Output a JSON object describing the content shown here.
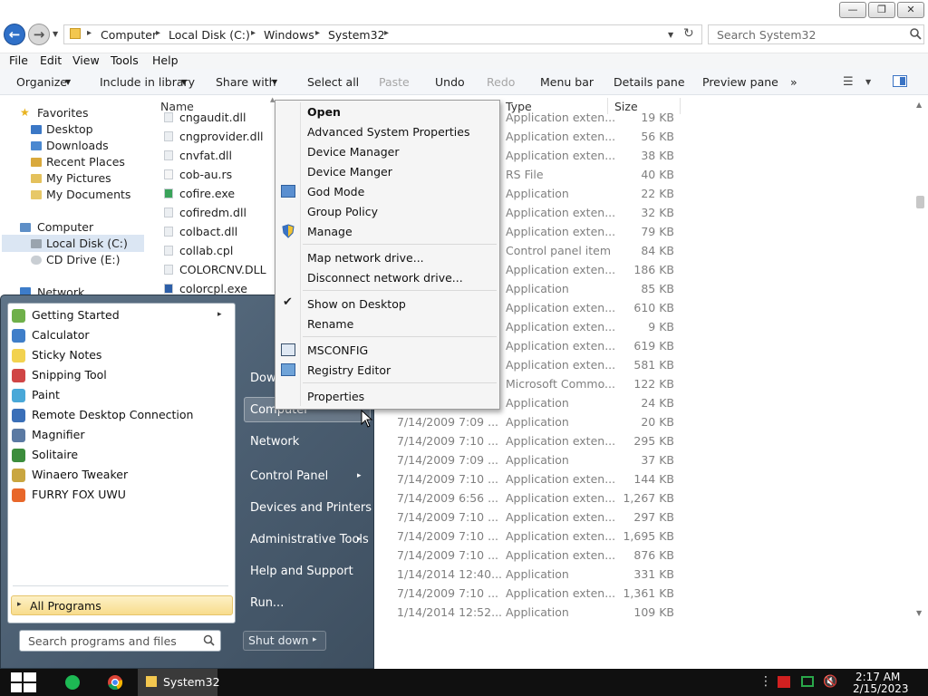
{
  "breadcrumb": [
    "Computer",
    "Local Disk (C:)",
    "Windows",
    "System32"
  ],
  "search": {
    "placeholder": "Search System32"
  },
  "menubar": [
    "File",
    "Edit",
    "View",
    "Tools",
    "Help"
  ],
  "commandbar": {
    "organize": "Organize",
    "include": "Include in library",
    "share": "Share with",
    "selectall": "Select all",
    "paste": "Paste",
    "undo": "Undo",
    "redo": "Redo",
    "menubar": "Menu bar",
    "details": "Details pane",
    "preview": "Preview pane",
    "more": "»"
  },
  "nav": {
    "favorites": "Favorites",
    "desktop": "Desktop",
    "downloads": "Downloads",
    "recent": "Recent Places",
    "pictures": "My Pictures",
    "documents": "My Documents",
    "computer": "Computer",
    "localdisk": "Local Disk (C:)",
    "cddrive": "CD Drive (E:)",
    "network": "Network"
  },
  "columns": {
    "name": "Name",
    "type": "Type",
    "size": "Size"
  },
  "files": [
    {
      "name": "cngaudit.dll",
      "date": "",
      "type": "Application exten...",
      "size": "19 KB"
    },
    {
      "name": "cngprovider.dll",
      "date": "",
      "type": "Application exten...",
      "size": "56 KB"
    },
    {
      "name": "cnvfat.dll",
      "date": "",
      "type": "Application exten...",
      "size": "38 KB"
    },
    {
      "name": "cob-au.rs",
      "date": "",
      "type": "RS File",
      "size": "40 KB"
    },
    {
      "name": "cofire.exe",
      "date": "",
      "type": "Application",
      "size": "22 KB"
    },
    {
      "name": "cofiredm.dll",
      "date": "",
      "type": "Application exten...",
      "size": "32 KB"
    },
    {
      "name": "colbact.dll",
      "date": "",
      "type": "Application exten...",
      "size": "79 KB"
    },
    {
      "name": "collab.cpl",
      "date": "",
      "type": "Control panel item",
      "size": "84 KB"
    },
    {
      "name": "COLORCNV.DLL",
      "date": "",
      "type": "Application exten...",
      "size": "186 KB"
    },
    {
      "name": "colorcpl.exe",
      "date": "",
      "type": "Application",
      "size": "85 KB"
    },
    {
      "name": "",
      "date": "",
      "type": "Application exten...",
      "size": "610 KB"
    },
    {
      "name": "",
      "date": "",
      "type": "Application exten...",
      "size": "9 KB"
    },
    {
      "name": "",
      "date": "",
      "type": "Application exten...",
      "size": "619 KB"
    },
    {
      "name": "",
      "date": "",
      "type": "Application exten...",
      "size": "581 KB"
    },
    {
      "name": "",
      "date": "",
      "type": "Microsoft Commo...",
      "size": "122 KB"
    },
    {
      "name": "",
      "date": "",
      "type": "Application",
      "size": "24 KB"
    },
    {
      "name": "",
      "date": "7/14/2009 7:09 ...",
      "type": "Application",
      "size": "20 KB"
    },
    {
      "name": "",
      "date": "7/14/2009 7:10 ...",
      "type": "Application exten...",
      "size": "295 KB"
    },
    {
      "name": "",
      "date": "7/14/2009 7:09 ...",
      "type": "Application",
      "size": "37 KB"
    },
    {
      "name": "",
      "date": "7/14/2009 7:10 ...",
      "type": "Application exten...",
      "size": "144 KB"
    },
    {
      "name": "",
      "date": "7/14/2009 6:56 ...",
      "type": "Application exten...",
      "size": "1,267 KB"
    },
    {
      "name": "",
      "date": "7/14/2009 7:10 ...",
      "type": "Application exten...",
      "size": "297 KB"
    },
    {
      "name": "",
      "date": "7/14/2009 7:10 ...",
      "type": "Application exten...",
      "size": "1,695 KB"
    },
    {
      "name": "",
      "date": "7/14/2009 7:10 ...",
      "type": "Application exten...",
      "size": "876 KB"
    },
    {
      "name": "",
      "date": "1/14/2014 12:40...",
      "type": "Application",
      "size": "331 KB"
    },
    {
      "name": "",
      "date": "7/14/2009 7:10 ...",
      "type": "Application exten...",
      "size": "1,361 KB"
    },
    {
      "name": "",
      "date": "1/14/2014 12:52...",
      "type": "Application",
      "size": "109 KB"
    }
  ],
  "startmenu": {
    "pinned": [
      "Getting Started",
      "Calculator",
      "Sticky Notes",
      "Snipping Tool",
      "Paint",
      "Remote Desktop Connection",
      "Magnifier",
      "Solitaire",
      "Winaero Tweaker",
      "FURRY FOX UWU"
    ],
    "allprograms": "All Programs",
    "search_placeholder": "Search programs and files",
    "right": {
      "downloads": "Down",
      "computer": "Computer",
      "network": "Network",
      "control": "Control Panel",
      "devices": "Devices and Printers",
      "admin": "Administrative Tools",
      "help": "Help and Support",
      "run": "Run..."
    },
    "shutdown": "Shut down"
  },
  "context": {
    "open": "Open",
    "advsys": "Advanced System Properties",
    "devmgr": "Device Manager",
    "devmgr2": "Device Manger",
    "godmode": "God Mode",
    "grouppolicy": "Group Policy",
    "manage": "Manage",
    "mapdrive": "Map network drive...",
    "disconnect": "Disconnect network drive...",
    "showdesktop": "Show on Desktop",
    "rename": "Rename",
    "msconfig": "MSCONFIG",
    "regedit": "Registry Editor",
    "properties": "Properties"
  },
  "taskbar": {
    "window": "System32",
    "time": "2:17 AM",
    "date": "2/15/2023"
  }
}
